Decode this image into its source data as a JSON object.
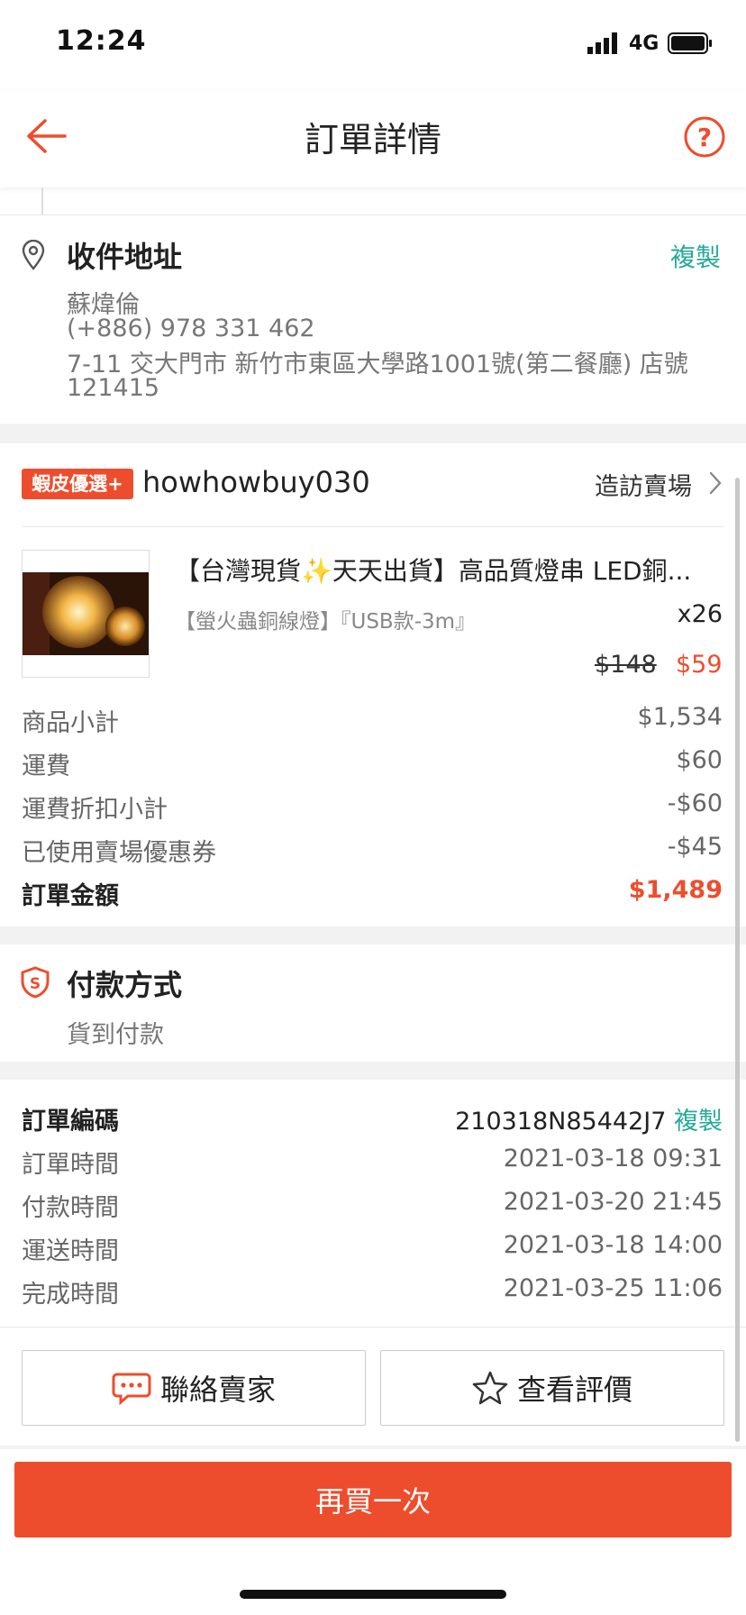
{
  "status_bar": {
    "time": "12:24",
    "network": "4G"
  },
  "nav": {
    "title": "訂單詳情"
  },
  "address": {
    "title": "收件地址",
    "copy_label": "複製",
    "name": "蘇煒倫",
    "phone": "(+886) 978 331 462",
    "line1": "7-11 交大門市 新竹市東區大學路1001號(第二餐廳) 店號",
    "line2": "121415"
  },
  "shop": {
    "badge": "蝦皮優選+",
    "name": "howhowbuy030",
    "visit_label": "造訪賣場"
  },
  "product": {
    "name": "【台灣現貨✨天天出貨】高品質燈串 LED銅...",
    "variant": "【螢火蟲銅線燈】『USB款-3m』",
    "quantity": "x26",
    "original_price": "$148",
    "price": "$59"
  },
  "summary": {
    "rows": [
      {
        "label": "商品小計",
        "value": "$1,534"
      },
      {
        "label": "運費",
        "value": "$60"
      },
      {
        "label": "運費折扣小計",
        "value": "-$60"
      },
      {
        "label": "已使用賣場優惠券",
        "value": "-$45"
      }
    ],
    "total_label": "訂單金額",
    "total_value": "$1,489"
  },
  "payment": {
    "title": "付款方式",
    "method": "貨到付款"
  },
  "order_info": {
    "id_label": "訂單編碼",
    "id_value": "210318N85442J7",
    "copy_label": "複製",
    "rows": [
      {
        "label": "訂單時間",
        "value": "2021-03-18 09:31"
      },
      {
        "label": "付款時間",
        "value": "2021-03-20 21:45"
      },
      {
        "label": "運送時間",
        "value": "2021-03-18 14:00"
      },
      {
        "label": "完成時間",
        "value": "2021-03-25 11:06"
      }
    ]
  },
  "actions": {
    "contact_label": "聯絡賣家",
    "review_label": "查看評價",
    "buy_again_label": "再買一次"
  },
  "colors": {
    "accent": "#ee4d2d",
    "teal": "#26aa99"
  }
}
